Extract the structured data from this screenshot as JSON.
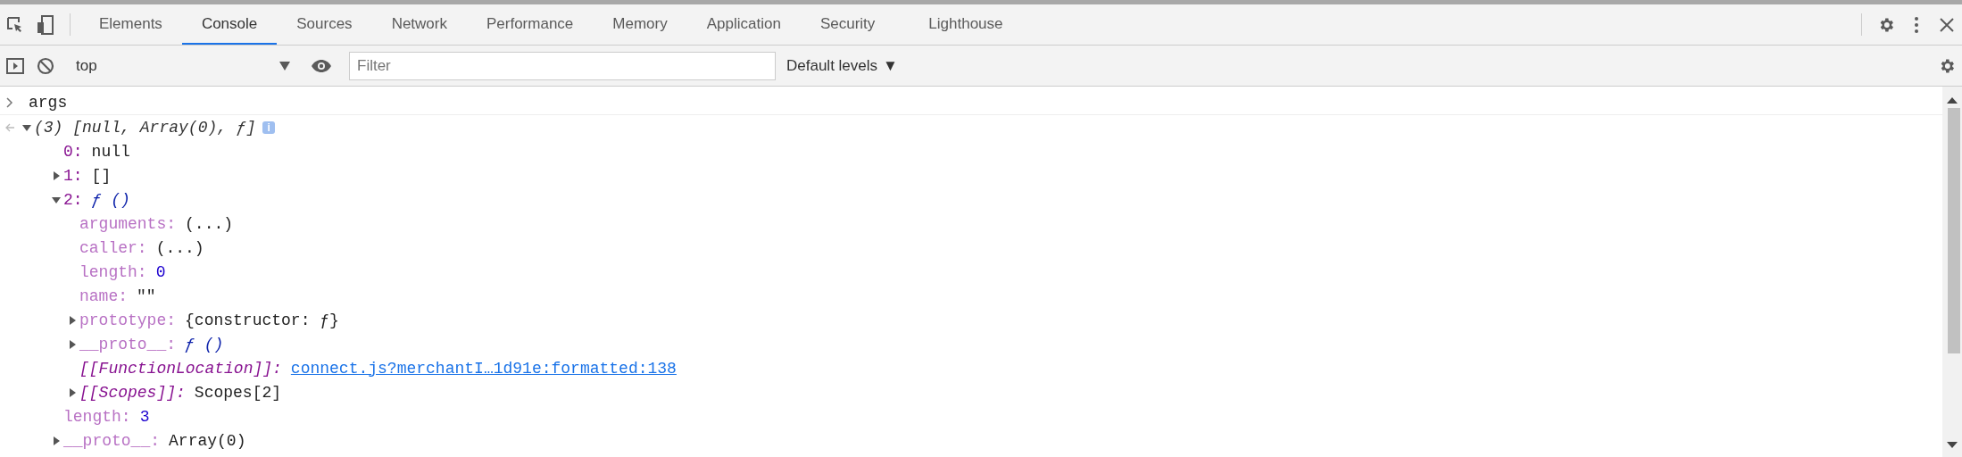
{
  "panel_tabs": [
    {
      "label": "Elements",
      "selected": false
    },
    {
      "label": "Console",
      "selected": true
    },
    {
      "label": "Sources",
      "selected": false
    },
    {
      "label": "Network",
      "selected": false
    },
    {
      "label": "Performance",
      "selected": false
    },
    {
      "label": "Memory",
      "selected": false
    },
    {
      "label": "Application",
      "selected": false
    },
    {
      "label": "Security",
      "selected": false
    },
    {
      "label": "Lighthouse",
      "selected": false
    }
  ],
  "toolbar": {
    "context": "top",
    "filter": {
      "placeholder": "Filter"
    },
    "levels": "Default levels",
    "levels_caret": "▼"
  },
  "console": {
    "input": "args",
    "result": {
      "summary": "(3) [null, Array(0), ƒ]",
      "info_badge": "i",
      "expanded": true,
      "children": [
        {
          "key": {
            "text": "0:",
            "kind": "index"
          },
          "value": {
            "text": "null",
            "kind": "plain"
          }
        },
        {
          "key": {
            "text": "1:",
            "kind": "index"
          },
          "value": {
            "text": "[]",
            "kind": "plain"
          },
          "expanded": false
        },
        {
          "key": {
            "text": "2:",
            "kind": "index"
          },
          "value": {
            "text": "ƒ ()",
            "kind": "function"
          },
          "expanded": true,
          "children": [
            {
              "key": {
                "text": "arguments:",
                "kind": "hidden"
              },
              "value": {
                "text": "(...)",
                "kind": "plain"
              }
            },
            {
              "key": {
                "text": "caller:",
                "kind": "hidden"
              },
              "value": {
                "text": "(...)",
                "kind": "plain"
              }
            },
            {
              "key": {
                "text": "length:",
                "kind": "hidden"
              },
              "value": {
                "text": "0",
                "kind": "number"
              }
            },
            {
              "key": {
                "text": "name:",
                "kind": "hidden"
              },
              "value": {
                "text": "\"\"",
                "kind": "plain"
              }
            },
            {
              "key": {
                "text": "prototype:",
                "kind": "hidden"
              },
              "value": {
                "text": "{constructor: ƒ}",
                "kind": "plain"
              },
              "expanded": false
            },
            {
              "key": {
                "text": "__proto__:",
                "kind": "hidden"
              },
              "value": {
                "text": "ƒ ()",
                "kind": "function"
              },
              "expanded": false
            },
            {
              "key": {
                "text": "[[FunctionLocation]]:",
                "kind": "internal"
              },
              "value": {
                "text": "connect.js?merchantI…1d91e:formatted:138",
                "kind": "link"
              }
            },
            {
              "key": {
                "text": "[[Scopes]]:",
                "kind": "internal"
              },
              "value": {
                "text": "Scopes[2]",
                "kind": "plain"
              },
              "expanded": false
            }
          ]
        },
        {
          "key": {
            "text": "length:",
            "kind": "hidden"
          },
          "value": {
            "text": "3",
            "kind": "number"
          }
        },
        {
          "key": {
            "text": "__proto__:",
            "kind": "hidden"
          },
          "value": {
            "text": "Array(0)",
            "kind": "plain"
          },
          "expanded": false
        }
      ]
    }
  }
}
